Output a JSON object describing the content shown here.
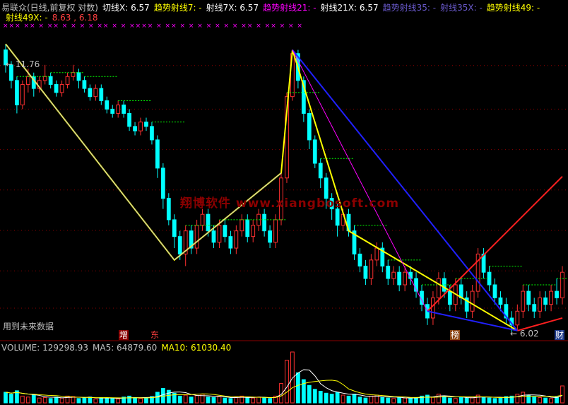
{
  "header": {
    "line1": [
      {
        "text": "易联众(日线,前复权 对数)",
        "color": "#c0c0c0"
      },
      {
        "text": "切线X: 6.57",
        "color": "#ffffff"
      },
      {
        "text": "趋势射线7: -",
        "color": "#ffff00"
      },
      {
        "text": "射线7X: 6.57",
        "color": "#ffffff"
      },
      {
        "text": "趋势射线21: -",
        "color": "#ff00ff"
      },
      {
        "text": "射线21X: 6.57",
        "color": "#ffffff"
      },
      {
        "text": "趋势射线35: -",
        "color": "#6a5acd"
      },
      {
        "text": "射线35X: -",
        "color": "#6a5acd"
      },
      {
        "text": "趋势射线49: -",
        "color": "#ffff00"
      }
    ],
    "line2": [
      {
        "text": "射线49X: -",
        "color": "#ffff00"
      },
      {
        "text": "8.63 , 6.18",
        "color": "#ff4040"
      }
    ],
    "marks_text": "××× ×× × ×× × × × × ×× × × ×××× × ×× × × × × × × × ×× × ×× × × ×"
  },
  "chart": {
    "high_label": "← 11.76",
    "low_label": "← 6.02",
    "watermark": "翔博软件 www.xiangbosoft.com",
    "future_data_note": "用到未来数据",
    "event_markers": [
      {
        "text": "增",
        "color": "#ffffff",
        "bg": "#8b0000"
      },
      {
        "text": "东",
        "color": "#ff4040",
        "bg": "transparent"
      },
      {
        "text": "榜",
        "color": "#ffffff",
        "bg": "#8b4513"
      },
      {
        "text": "财",
        "color": "#ffffff",
        "bg": "#1e3a8a"
      }
    ],
    "colors": {
      "up": "#ff3030",
      "down": "#00ffff",
      "grid": "#8b0000",
      "ray_yellow": "#ffff00",
      "ray_blue": "#2020ff",
      "ray_red": "#ff2020",
      "ray_magenta": "#ff00ff",
      "ray_white": "#c0c0c0",
      "pivot_dash": "#00ff00"
    }
  },
  "volume": {
    "items": [
      {
        "text": "VOLUME: 129298.93",
        "color": "#c0c0c0"
      },
      {
        "text": "MA5: 64879.60",
        "color": "#c0c0c0"
      },
      {
        "text": "MA10: 61030.40",
        "color": "#ffff00"
      }
    ]
  },
  "chart_data": {
    "type": "candlestick",
    "price_range": [
      6.02,
      11.76
    ],
    "price_labels": {
      "high": 11.76,
      "low": 6.02,
      "last_pair": [
        8.63,
        6.18
      ]
    },
    "candles": [
      [
        11.6,
        11.2,
        11.76,
        11.0
      ],
      [
        11.2,
        10.8,
        11.3,
        10.6
      ],
      [
        10.8,
        10.2,
        10.9,
        10.0
      ],
      [
        10.2,
        10.7,
        10.8,
        10.1
      ],
      [
        10.7,
        10.9,
        11.1,
        10.5
      ],
      [
        10.9,
        10.6,
        11.0,
        10.4
      ],
      [
        10.6,
        10.8,
        10.9,
        10.5
      ],
      [
        10.8,
        10.9,
        11.2,
        10.7
      ],
      [
        10.9,
        10.7,
        11.0,
        10.6
      ],
      [
        10.7,
        10.5,
        10.8,
        10.4
      ],
      [
        10.5,
        10.7,
        10.8,
        10.4
      ],
      [
        10.7,
        10.9,
        11.0,
        10.6
      ],
      [
        10.9,
        11.0,
        11.2,
        10.8
      ],
      [
        11.0,
        10.8,
        11.1,
        10.6
      ],
      [
        10.8,
        10.6,
        10.9,
        10.5
      ],
      [
        10.6,
        10.4,
        10.7,
        10.3
      ],
      [
        10.4,
        10.6,
        10.7,
        10.3
      ],
      [
        10.6,
        10.3,
        10.7,
        10.2
      ],
      [
        10.3,
        10.1,
        10.4,
        10.0
      ],
      [
        10.1,
        10.0,
        10.2,
        9.9
      ],
      [
        10.0,
        10.2,
        10.3,
        9.9
      ],
      [
        10.2,
        10.0,
        10.3,
        9.9
      ],
      [
        10.0,
        9.7,
        10.1,
        9.6
      ],
      [
        9.7,
        9.6,
        9.8,
        9.5
      ],
      [
        9.6,
        9.8,
        9.9,
        9.5
      ],
      [
        9.8,
        9.7,
        9.9,
        9.6
      ],
      [
        9.7,
        9.4,
        9.8,
        9.3
      ],
      [
        9.4,
        8.8,
        9.5,
        8.6
      ],
      [
        8.8,
        8.2,
        8.9,
        8.0
      ],
      [
        8.2,
        7.8,
        8.3,
        7.7
      ],
      [
        7.8,
        7.5,
        7.9,
        7.3
      ],
      [
        7.5,
        7.2,
        7.6,
        7.1
      ],
      [
        7.2,
        7.6,
        7.7,
        7.0
      ],
      [
        7.6,
        7.3,
        7.7,
        7.2
      ],
      [
        7.3,
        7.7,
        7.8,
        7.2
      ],
      [
        7.7,
        7.9,
        8.0,
        7.6
      ],
      [
        7.9,
        7.6,
        8.0,
        7.5
      ],
      [
        7.6,
        7.4,
        7.7,
        7.3
      ],
      [
        7.4,
        7.7,
        7.8,
        7.3
      ],
      [
        7.7,
        7.5,
        7.8,
        7.4
      ],
      [
        7.5,
        7.3,
        7.6,
        7.2
      ],
      [
        7.3,
        7.6,
        7.7,
        7.2
      ],
      [
        7.6,
        7.8,
        7.9,
        7.5
      ],
      [
        7.8,
        7.5,
        7.9,
        7.4
      ],
      [
        7.5,
        7.7,
        7.8,
        7.4
      ],
      [
        7.7,
        7.9,
        8.0,
        7.6
      ],
      [
        7.9,
        7.6,
        8.0,
        7.5
      ],
      [
        7.6,
        7.4,
        7.7,
        7.3
      ],
      [
        7.4,
        7.8,
        7.9,
        7.3
      ],
      [
        7.8,
        8.6,
        8.7,
        7.7
      ],
      [
        8.6,
        10.4,
        10.5,
        8.5
      ],
      [
        10.4,
        11.5,
        11.6,
        10.3
      ],
      [
        11.5,
        10.8,
        11.6,
        10.6
      ],
      [
        10.8,
        10.0,
        10.9,
        9.8
      ],
      [
        10.0,
        9.4,
        10.1,
        9.2
      ],
      [
        9.4,
        8.9,
        9.5,
        8.8
      ],
      [
        8.9,
        8.6,
        9.0,
        8.4
      ],
      [
        8.6,
        8.2,
        8.7,
        8.0
      ],
      [
        8.2,
        8.0,
        8.3,
        7.8
      ],
      [
        8.0,
        7.7,
        8.1,
        7.5
      ],
      [
        7.7,
        7.9,
        8.0,
        7.6
      ],
      [
        7.9,
        7.6,
        8.0,
        7.5
      ],
      [
        7.6,
        7.2,
        7.7,
        7.1
      ],
      [
        7.2,
        7.0,
        7.3,
        6.9
      ],
      [
        7.0,
        6.8,
        7.1,
        6.7
      ],
      [
        6.8,
        7.1,
        7.2,
        6.7
      ],
      [
        7.1,
        7.3,
        7.4,
        7.0
      ],
      [
        7.3,
        7.0,
        7.4,
        6.9
      ],
      [
        7.0,
        6.8,
        7.1,
        6.7
      ],
      [
        6.8,
        6.9,
        7.0,
        6.7
      ],
      [
        6.9,
        6.7,
        7.0,
        6.6
      ],
      [
        6.7,
        6.9,
        7.0,
        6.6
      ],
      [
        6.9,
        6.8,
        7.0,
        6.7
      ],
      [
        6.8,
        6.6,
        6.9,
        6.5
      ],
      [
        6.6,
        6.4,
        6.7,
        6.3
      ],
      [
        6.4,
        6.2,
        6.5,
        6.1
      ],
      [
        6.2,
        6.5,
        6.6,
        6.1
      ],
      [
        6.5,
        6.8,
        6.9,
        6.4
      ],
      [
        6.8,
        6.6,
        6.9,
        6.5
      ],
      [
        6.6,
        6.4,
        6.7,
        6.3
      ],
      [
        6.4,
        6.7,
        6.8,
        6.3
      ],
      [
        6.7,
        6.5,
        6.8,
        6.4
      ],
      [
        6.5,
        6.3,
        6.6,
        6.2
      ],
      [
        6.3,
        6.6,
        6.7,
        6.2
      ],
      [
        6.6,
        7.2,
        7.3,
        6.5
      ],
      [
        7.2,
        6.9,
        7.3,
        6.8
      ],
      [
        6.9,
        6.7,
        7.0,
        6.6
      ],
      [
        6.7,
        6.5,
        6.8,
        6.4
      ],
      [
        6.5,
        6.4,
        6.6,
        6.3
      ],
      [
        6.4,
        6.2,
        6.5,
        6.1
      ],
      [
        6.2,
        6.1,
        6.3,
        6.0
      ],
      [
        6.1,
        6.3,
        6.4,
        6.02
      ],
      [
        6.3,
        6.6,
        6.7,
        6.2
      ],
      [
        6.6,
        6.4,
        6.7,
        6.3
      ],
      [
        6.4,
        6.3,
        6.5,
        6.2
      ],
      [
        6.3,
        6.5,
        6.6,
        6.2
      ],
      [
        6.5,
        6.4,
        6.6,
        6.3
      ],
      [
        6.4,
        6.6,
        6.7,
        6.3
      ],
      [
        6.6,
        6.5,
        6.8,
        6.4
      ],
      [
        6.5,
        6.9,
        7.0,
        6.4
      ]
    ],
    "volumes": [
      22,
      18,
      25,
      14,
      12,
      16,
      10,
      11,
      9,
      12,
      10,
      14,
      13,
      9,
      10,
      12,
      8,
      11,
      10,
      9,
      8,
      12,
      14,
      11,
      9,
      10,
      13,
      22,
      30,
      26,
      20,
      14,
      16,
      12,
      15,
      18,
      12,
      11,
      13,
      10,
      9,
      12,
      14,
      11,
      10,
      12,
      11,
      9,
      14,
      40,
      88,
      105,
      62,
      48,
      36,
      28,
      24,
      20,
      18,
      22,
      16,
      14,
      18,
      12,
      10,
      14,
      16,
      11,
      10,
      9,
      12,
      10,
      9,
      11,
      14,
      16,
      12,
      18,
      14,
      10,
      9,
      12,
      10,
      11,
      16,
      12,
      10,
      9,
      11,
      13,
      14,
      18,
      22,
      16,
      12,
      11,
      10,
      9,
      12,
      35
    ],
    "pivots": [
      {
        "kind": "high",
        "price": 11.76
      },
      {
        "kind": "low",
        "price": 6.02
      }
    ],
    "rays": [
      {
        "name": "yellow",
        "color": "yellow"
      },
      {
        "name": "blue",
        "color": "blue"
      },
      {
        "name": "red",
        "color": "red"
      },
      {
        "name": "magenta",
        "color": "magenta"
      }
    ],
    "ylim": [
      5.9,
      12.2
    ]
  }
}
